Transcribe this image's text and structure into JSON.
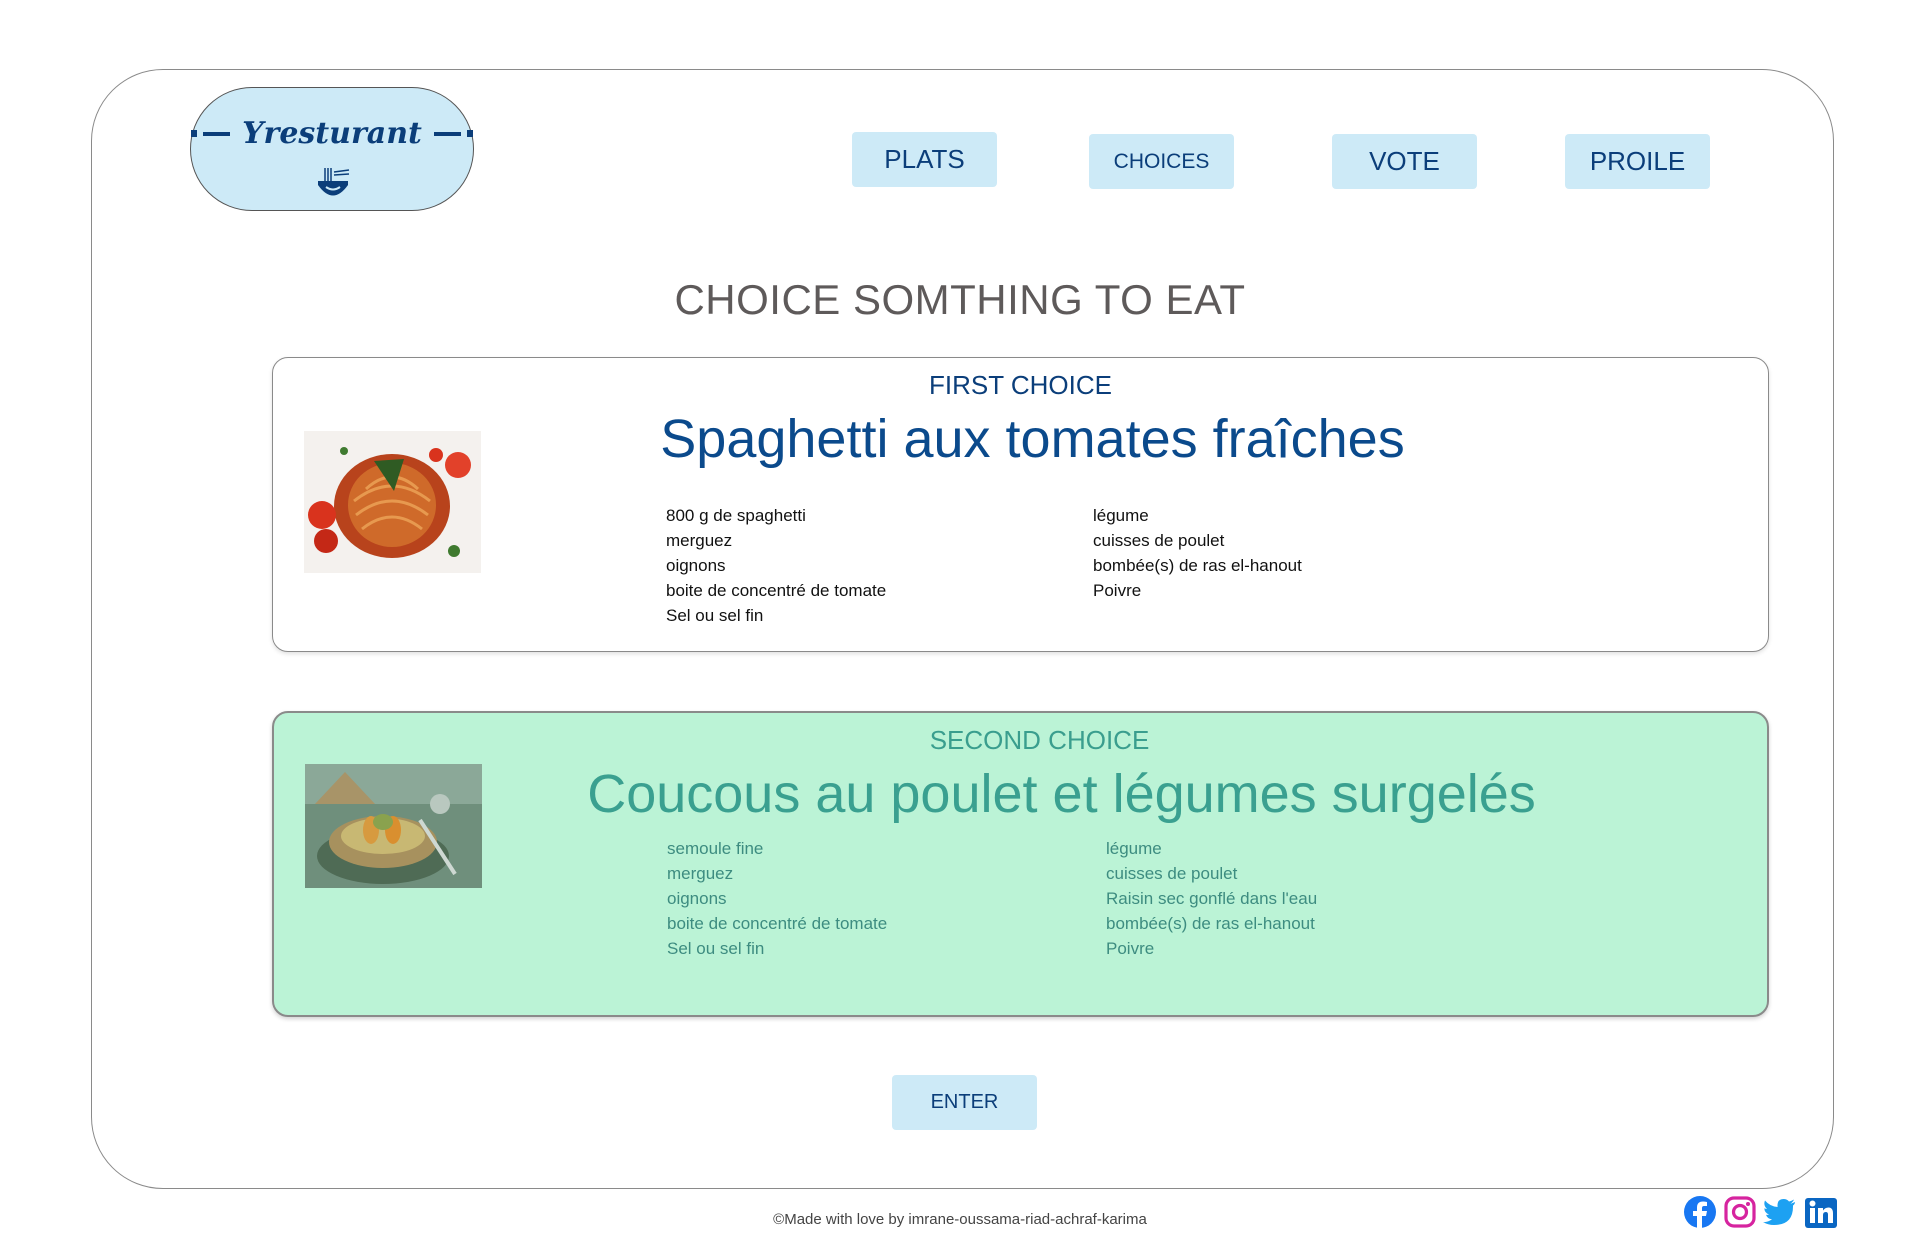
{
  "brand": {
    "name": "Yresturant",
    "logo_icon": "noodle-bowl-icon",
    "colors": {
      "primary": "#0b3e7a",
      "light": "#cdeaf7",
      "selected": "#bbf3d6"
    }
  },
  "nav": {
    "plats": "PLATS",
    "choices": "CHOICES",
    "vote": "VOTE",
    "profile": "PROILE"
  },
  "page_title": "CHOICE SOMTHING TO EAT",
  "choices": [
    {
      "label": "FIRST CHOICE",
      "dish": "Spaghetti aux tomates fraîches",
      "image_icon": "spaghetti-image",
      "ingredients_left": [
        "800 g de spaghetti",
        "merguez",
        "oignons",
        "boite de concentré de tomate",
        "Sel ou sel fin"
      ],
      "ingredients_right": [
        "légume",
        "cuisses de poulet",
        "bombée(s) de ras el-hanout",
        "Poivre"
      ]
    },
    {
      "label": "SECOND CHOICE",
      "dish": "Coucous au poulet et légumes surgelés",
      "image_icon": "couscous-image",
      "ingredients_left": [
        "semoule fine",
        "merguez",
        "oignons",
        "boite de concentré de tomate",
        "Sel ou sel fin"
      ],
      "ingredients_right": [
        "légume",
        "cuisses de poulet",
        "Raisin sec gonflé dans l'eau",
        "bombée(s) de ras el-hanout",
        "Poivre"
      ]
    }
  ],
  "enter_label": "ENTER",
  "footer": "©Made with love by  imrane-oussama-riad-achraf-karima",
  "social_icons": [
    "facebook-icon",
    "instagram-icon",
    "twitter-icon",
    "linkedin-icon"
  ]
}
